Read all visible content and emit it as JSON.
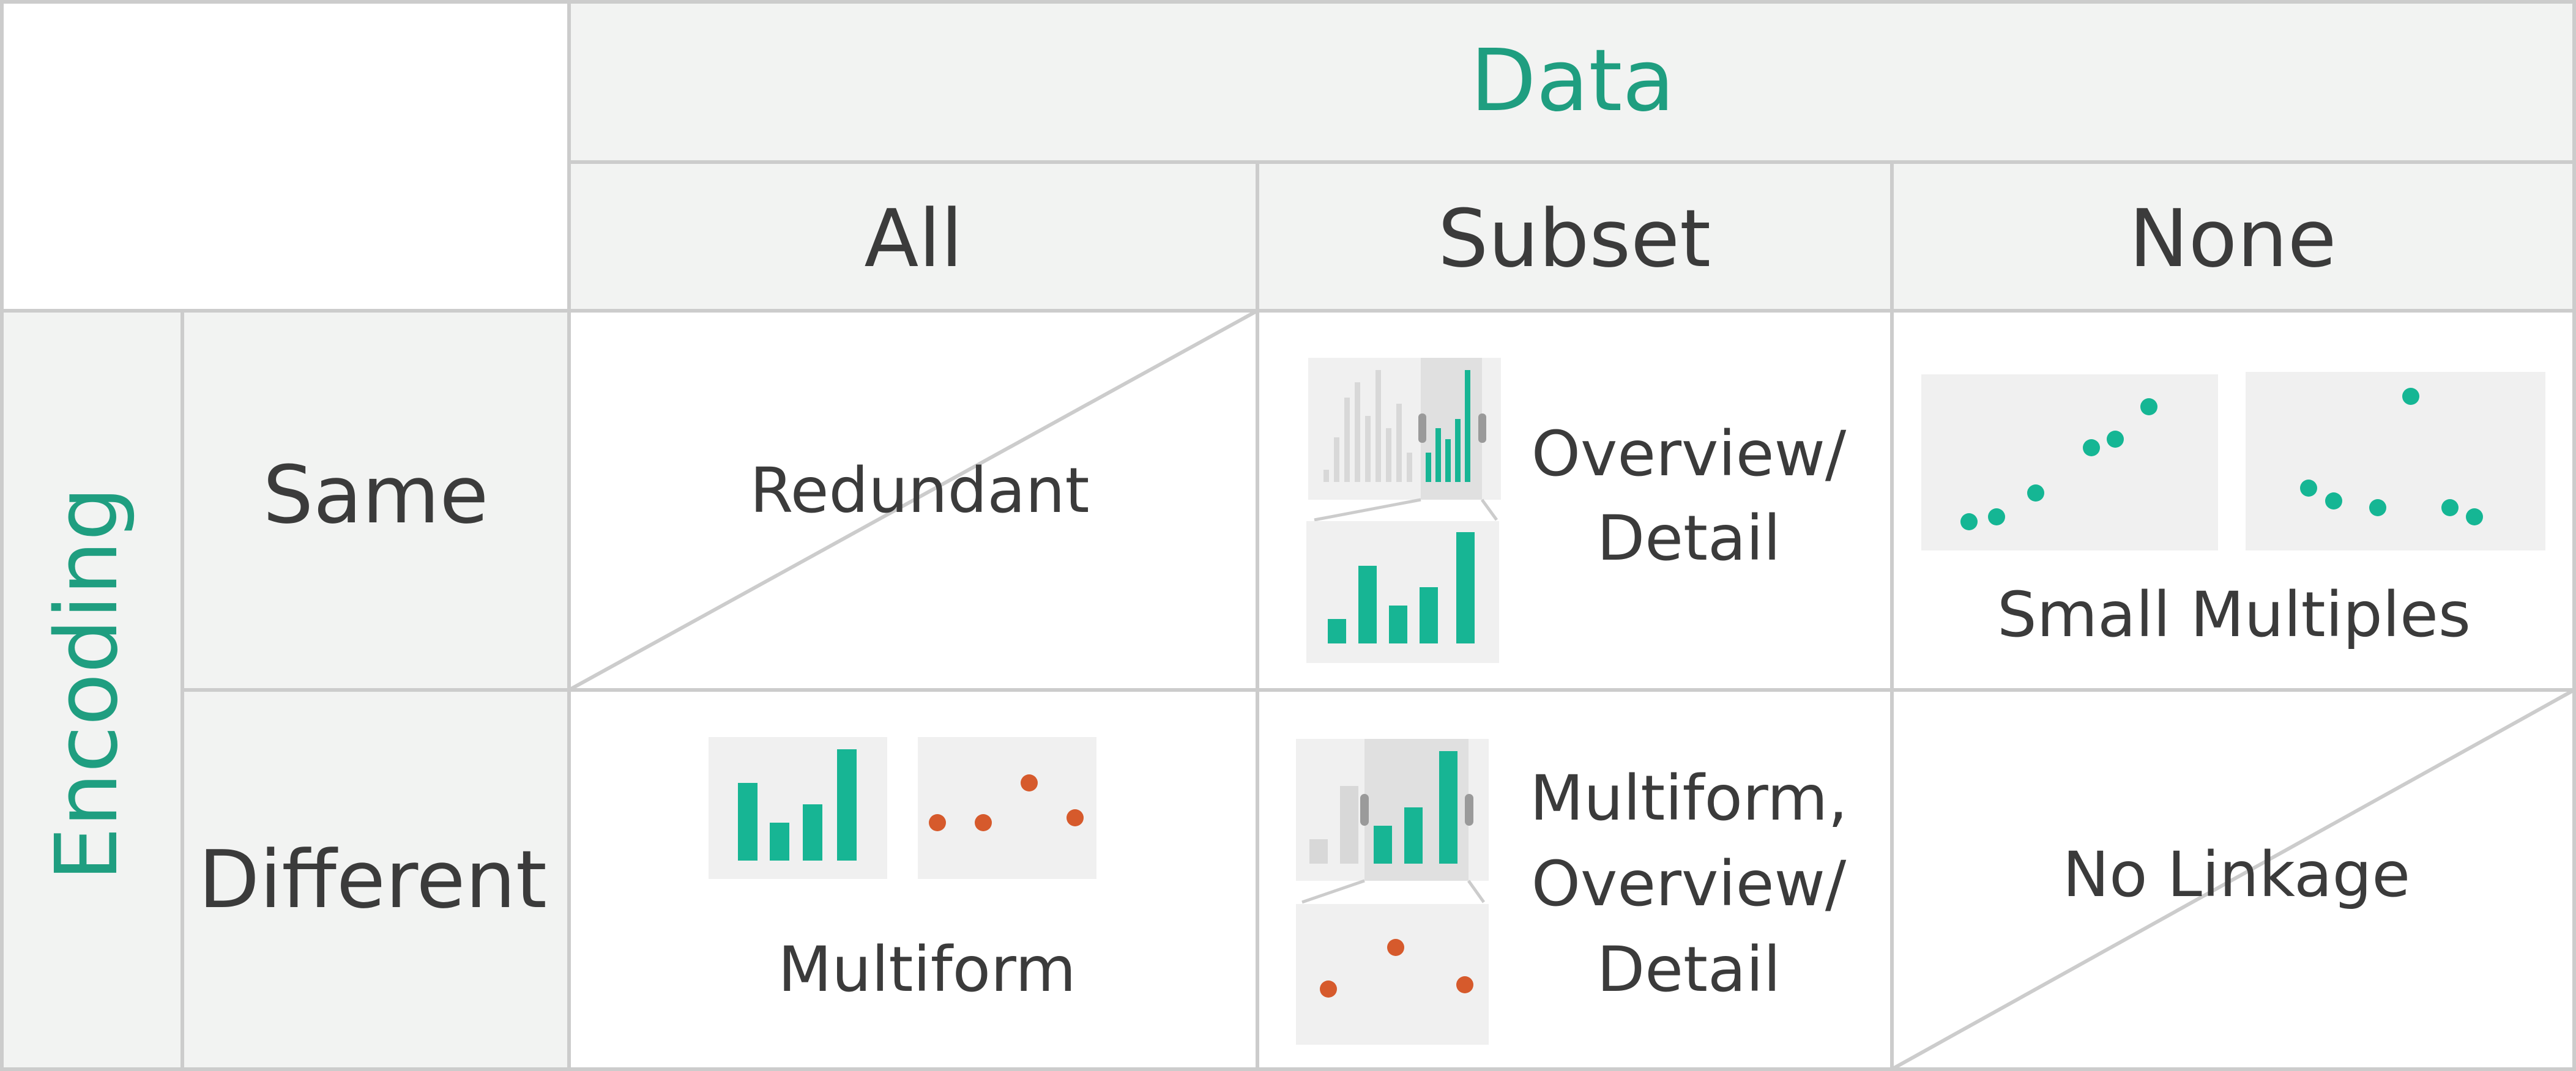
{
  "header": {
    "data_title": "Data",
    "columns": [
      "All",
      "Subset",
      "None"
    ]
  },
  "rows_header": {
    "encoding_title": "Encoding",
    "rows": [
      "Same",
      "Different"
    ]
  },
  "cells": {
    "same_all": "Redundant",
    "same_subset": [
      "Overview/",
      "Detail"
    ],
    "same_none": "Small Multiples",
    "different_all": "Multiform",
    "different_subset": [
      "Multiform,",
      "Overview/",
      "Detail"
    ],
    "different_none": "No Linkage"
  },
  "colors": {
    "accent": "#1f9e80",
    "bar": "#17b594",
    "dot_teal": "#15b694",
    "dot_orange": "#d65a2c",
    "header_fill": "#f2f3f2",
    "grid": "#cccccc",
    "context_bar": "#d8d8d8",
    "text": "#3b3b3b"
  },
  "icons": [
    "bar-chart-thumbnail",
    "scatter-plot-thumbnail",
    "brush-handle"
  ]
}
